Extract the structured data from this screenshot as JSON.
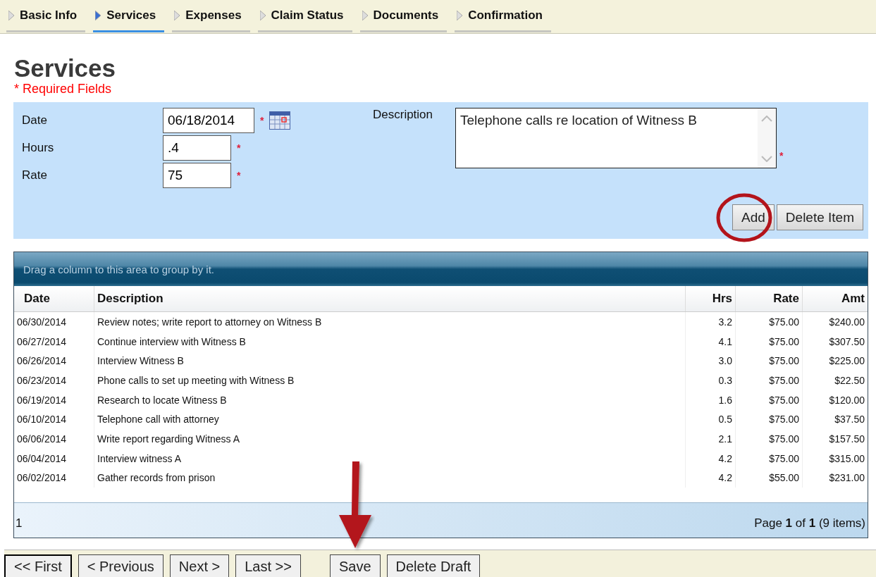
{
  "tabs": [
    {
      "label": "Basic Info",
      "selected": false
    },
    {
      "label": "Services",
      "selected": true
    },
    {
      "label": "Expenses",
      "selected": false
    },
    {
      "label": "Claim Status",
      "selected": false
    },
    {
      "label": "Documents",
      "selected": false
    },
    {
      "label": "Confirmation",
      "selected": false
    }
  ],
  "title": "Services",
  "required_note": "* Required Fields",
  "form": {
    "fields": [
      {
        "label": "Date",
        "value": "06/18/2014",
        "required_mark": "*",
        "kind": "date"
      },
      {
        "label": "Hours",
        "value": ".4",
        "required_mark": "*",
        "kind": "text"
      },
      {
        "label": "Rate",
        "value": "75",
        "required_mark": "*",
        "kind": "text"
      }
    ],
    "description": {
      "label": "Description",
      "value": "Telephone calls re location of Witness B",
      "required_mark": "*"
    },
    "buttons": [
      {
        "label": "Add",
        "highlighted": true
      },
      {
        "label": "Delete Item",
        "highlighted": false
      }
    ]
  },
  "grid": {
    "group_hint": "Drag a column to this area to group by it.",
    "columns": [
      "Date",
      "Description",
      "Hrs",
      "Rate",
      "Amt"
    ],
    "rows": [
      [
        "06/30/2014",
        "Review notes; write report to attorney on Witness B",
        "3.2",
        "$75.00",
        "$240.00"
      ],
      [
        "06/27/2014",
        "Continue interview with Witness B",
        "4.1",
        "$75.00",
        "$307.50"
      ],
      [
        "06/26/2014",
        "Interview Witness B",
        "3.0",
        "$75.00",
        "$225.00"
      ],
      [
        "06/23/2014",
        "Phone calls to set up meeting with Witness B",
        "0.3",
        "$75.00",
        "$22.50"
      ],
      [
        "06/19/2014",
        "Research to locate Witness B",
        "1.6",
        "$75.00",
        "$120.00"
      ],
      [
        "06/10/2014",
        "Telephone call with attorney",
        "0.5",
        "$75.00",
        "$37.50"
      ],
      [
        "06/06/2014",
        "Write report regarding Witness A",
        "2.1",
        "$75.00",
        "$157.50"
      ],
      [
        "06/04/2014",
        "Interview witness A",
        "4.2",
        "$75.00",
        "$315.00"
      ],
      [
        "06/02/2014",
        "Gather records from prison",
        "4.2",
        "$55.00",
        "$231.00"
      ]
    ],
    "pager_page": "1",
    "pager_info": "Page **1** of **1** (9 items)"
  },
  "footer_buttons": [
    {
      "label": "<< First",
      "focused": true,
      "pointed_at": false
    },
    {
      "label": "< Previous",
      "focused": false,
      "pointed_at": false
    },
    {
      "label": "Next >",
      "focused": false,
      "pointed_at": false
    },
    {
      "label": "Last >>",
      "focused": false,
      "pointed_at": false
    },
    {
      "label": "Save",
      "focused": false,
      "pointed_at": true
    },
    {
      "label": "Delete Draft",
      "focused": false,
      "pointed_at": false
    }
  ]
}
